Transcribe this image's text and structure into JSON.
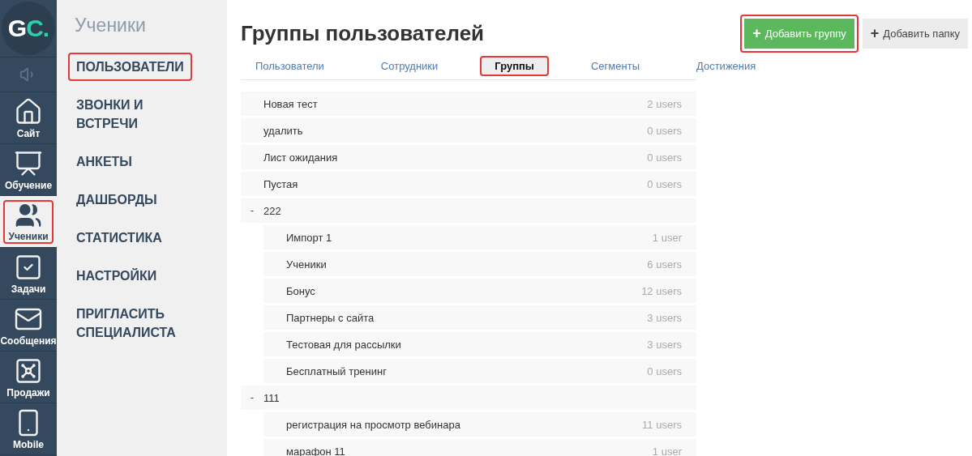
{
  "rail": {
    "logo": {
      "main": "G",
      "accent": "C."
    },
    "items": [
      {
        "kind": "speaker",
        "selected": false,
        "highlighted": false
      },
      {
        "kind": "home",
        "label": "Сайт",
        "selected": false,
        "highlighted": false
      },
      {
        "kind": "board",
        "label": "Обучение",
        "selected": false,
        "highlighted": false
      },
      {
        "kind": "people",
        "label": "Ученики",
        "selected": true,
        "highlighted": true
      },
      {
        "kind": "check",
        "label": "Задачи",
        "selected": false,
        "highlighted": false
      },
      {
        "kind": "mail",
        "label": "Сообщения",
        "selected": false,
        "highlighted": false
      },
      {
        "kind": "safe",
        "label": "Продажи",
        "selected": false,
        "highlighted": false
      },
      {
        "kind": "phone",
        "label": "Mobile",
        "selected": false,
        "highlighted": false
      }
    ]
  },
  "submenu": {
    "title": "Ученики",
    "items": [
      {
        "label": "ПОЛЬЗОВАТЕЛИ",
        "highlighted": true
      },
      {
        "label": "ЗВОНКИ И ВСТРЕЧИ",
        "highlighted": false
      },
      {
        "label": "АНКЕТЫ",
        "highlighted": false
      },
      {
        "label": "ДАШБОРДЫ",
        "highlighted": false
      },
      {
        "label": "СТАТИСТИКА",
        "highlighted": false
      },
      {
        "label": "НАСТРОЙКИ",
        "highlighted": false
      },
      {
        "label": "ПРИГЛАСИТЬ СПЕЦИАЛИСТА",
        "highlighted": false
      }
    ]
  },
  "page": {
    "title": "Группы пользователей",
    "buttons": [
      {
        "kind": "primary",
        "icon": "+",
        "label": "Добавить группу",
        "highlighted": true
      },
      {
        "kind": "secondary",
        "icon": "+",
        "label": "Добавить папку",
        "highlighted": false
      }
    ],
    "tabs": [
      {
        "label": "Пользователи",
        "selected": false,
        "highlighted": false
      },
      {
        "label": "Сотрудники",
        "selected": false,
        "highlighted": false
      },
      {
        "label": "Группы",
        "selected": true,
        "highlighted": true
      },
      {
        "label": "Сегменты",
        "selected": false,
        "highlighted": false
      },
      {
        "label": "Достижения",
        "selected": false,
        "highlighted": false
      }
    ],
    "groups": [
      {
        "name": "Новая тест",
        "count": "2 users"
      },
      {
        "name": "удалить",
        "count": "0 users"
      },
      {
        "name": "Лист ожидания",
        "count": "0 users"
      },
      {
        "name": "Пустая",
        "count": "0 users"
      },
      {
        "name": "222",
        "toggle": "-",
        "expanded": true,
        "children": [
          {
            "name": "Импорт 1",
            "count": "1 user"
          },
          {
            "name": "Ученики",
            "count": "6 users"
          },
          {
            "name": "Бонус",
            "count": "12 users"
          },
          {
            "name": "Партнеры с сайта",
            "count": "3 users"
          },
          {
            "name": "Тестовая для рассылки",
            "count": "3 users"
          },
          {
            "name": "Бесплатный тренинг",
            "count": "0 users"
          }
        ]
      },
      {
        "name": "111",
        "toggle": "-",
        "expanded": true,
        "children": [
          {
            "name": "регистрация на просмотр вебинара",
            "count": "11 users"
          },
          {
            "name": "марафон 11",
            "count": "1 user"
          }
        ]
      }
    ]
  }
}
